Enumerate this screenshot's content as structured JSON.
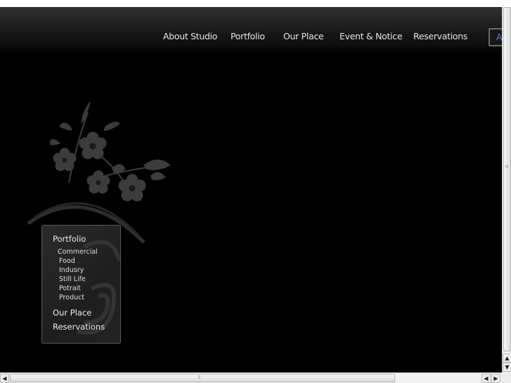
{
  "nav": {
    "items": [
      "About Studio",
      "Portfolio",
      "Our Place",
      "Event & Notice",
      "Reservations"
    ],
    "lang_button": "A"
  },
  "submenu": {
    "portfolio": "Portfolio",
    "portfolio_items": [
      "Commercial",
      "Food",
      "Indusry",
      "Still Life",
      "Potrait",
      "Product"
    ],
    "our_place": "Our Place",
    "reservations": "Reservations"
  },
  "colors": {
    "background": "#000000",
    "header": "#1c1c1c",
    "nav_text": "#e6e6e6",
    "lang_accent": "#5b7be0",
    "panel": "#222222"
  },
  "icons": [
    "flower-decoration",
    "scroll-up-arrow",
    "scroll-down-arrow",
    "scroll-left-arrow",
    "scroll-right-arrow"
  ]
}
